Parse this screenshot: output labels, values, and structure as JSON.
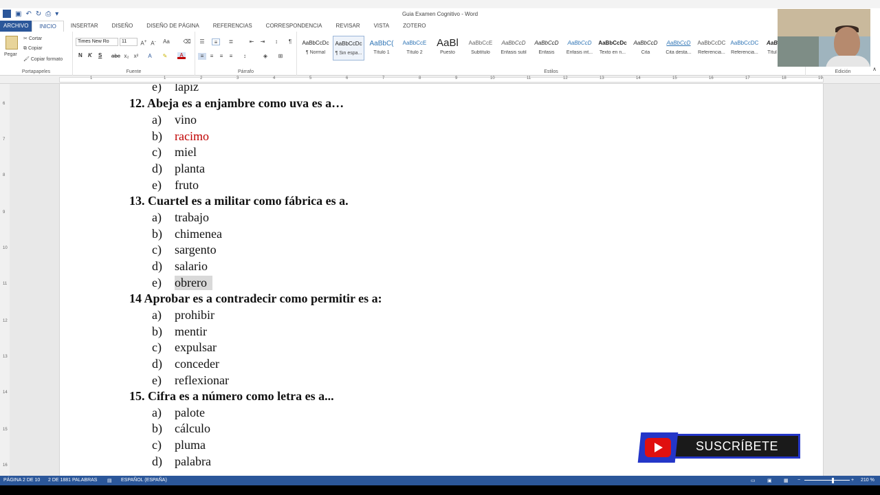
{
  "window": {
    "title": "Guia Examen Cognitivo - Word"
  },
  "tabs": [
    "ARCHIVO",
    "INICIO",
    "INSERTAR",
    "DISEÑO",
    "DISEÑO DE PÁGINA",
    "REFERENCIAS",
    "CORRESPONDENCIA",
    "REVISAR",
    "VISTA",
    "ZOTERO"
  ],
  "clipboard": {
    "paste": "Pegar",
    "cut": "Cortar",
    "copy": "Copiar",
    "format_painter": "Copiar formato",
    "label": "Portapapeles"
  },
  "font": {
    "name": "Times New Ro",
    "size": "11",
    "label": "Fuente"
  },
  "paragraph": {
    "label": "Párrafo"
  },
  "styles": {
    "label": "Estilos",
    "items": [
      {
        "preview": "AaBbCcDc",
        "name": "¶ Normal"
      },
      {
        "preview": "AaBbCcDc",
        "name": "¶ Sin espa..."
      },
      {
        "preview": "AaBbC(",
        "name": "Título 1"
      },
      {
        "preview": "AaBbCcE",
        "name": "Título 2"
      },
      {
        "preview": "AaBl",
        "name": "Puesto"
      },
      {
        "preview": "AaBbCcE",
        "name": "Subtítulo"
      },
      {
        "preview": "AaBbCcD",
        "name": "Énfasis sutil"
      },
      {
        "preview": "AaBbCcD",
        "name": "Énfasis"
      },
      {
        "preview": "AaBbCcD",
        "name": "Énfasis int..."
      },
      {
        "preview": "AaBbCcDc",
        "name": "Texto en n..."
      },
      {
        "preview": "AaBbCcD",
        "name": "Cita"
      },
      {
        "preview": "AaBbCcD",
        "name": "Cita desta..."
      },
      {
        "preview": "AaBbCcDC",
        "name": "Referencia..."
      },
      {
        "preview": "AaBbCcDC",
        "name": "Referencia..."
      },
      {
        "preview": "AaB",
        "name": "Títul"
      }
    ]
  },
  "editing": {
    "label": "Edición"
  },
  "ruler": {
    "numbers": [
      "1",
      "1",
      "2",
      "3",
      "4",
      "5",
      "6",
      "7",
      "8",
      "9",
      "10",
      "11",
      "12",
      "13",
      "14",
      "15",
      "16",
      "17",
      "18",
      "19"
    ]
  },
  "vruler": {
    "numbers": [
      "6",
      "7",
      "8",
      "9",
      "10",
      "11",
      "12",
      "13",
      "14",
      "15",
      "16"
    ]
  },
  "document": {
    "top_partial": {
      "letter": "e)",
      "text": "lápiz"
    },
    "questions": [
      {
        "title": "12. Abeja es a enjambre como uva es a…",
        "options": [
          {
            "letter": "a)",
            "text": "vino",
            "style": ""
          },
          {
            "letter": "b)",
            "text": "racimo",
            "style": "red"
          },
          {
            "letter": "c)",
            "text": "miel",
            "style": ""
          },
          {
            "letter": "d)",
            "text": "planta",
            "style": ""
          },
          {
            "letter": "e)",
            "text": "fruto",
            "style": ""
          }
        ]
      },
      {
        "title": "13. Cuartel es a militar como fábrica es a.",
        "options": [
          {
            "letter": "a)",
            "text": "trabajo",
            "style": ""
          },
          {
            "letter": "b)",
            "text": "chimenea",
            "style": ""
          },
          {
            "letter": "c)",
            "text": "sargento",
            "style": ""
          },
          {
            "letter": "d)",
            "text": "salario",
            "style": ""
          },
          {
            "letter": "e)",
            "text": "obrero",
            "style": "hl"
          }
        ]
      },
      {
        "title": "14 Aprobar es a contradecir como permitir es a:",
        "options": [
          {
            "letter": "a)",
            "text": "prohibir",
            "style": ""
          },
          {
            "letter": "b)",
            "text": "mentir",
            "style": ""
          },
          {
            "letter": "c)",
            "text": "expulsar",
            "style": ""
          },
          {
            "letter": "d)",
            "text": "conceder",
            "style": ""
          },
          {
            "letter": "e)",
            "text": "reflexionar",
            "style": ""
          }
        ]
      },
      {
        "title": "15. Cifra es a número como letra es a...",
        "options": [
          {
            "letter": "a)",
            "text": "palote",
            "style": ""
          },
          {
            "letter": "b)",
            "text": "cálculo",
            "style": ""
          },
          {
            "letter": "c)",
            "text": "pluma",
            "style": ""
          },
          {
            "letter": "d)",
            "text": "palabra",
            "style": ""
          }
        ]
      }
    ]
  },
  "status": {
    "page": "PÁGINA 2 DE 10",
    "words": "2 DE 1881 PALABRAS",
    "language": "ESPAÑOL (ESPAÑA)",
    "zoom": "210 %"
  },
  "overlay": {
    "subscribe": "SUSCRÍBETE"
  },
  "colors": {
    "word_blue": "#2b579a",
    "answer_red": "#c00000",
    "highlight_gray": "#d9d9d9",
    "youtube_red": "#e01010"
  }
}
